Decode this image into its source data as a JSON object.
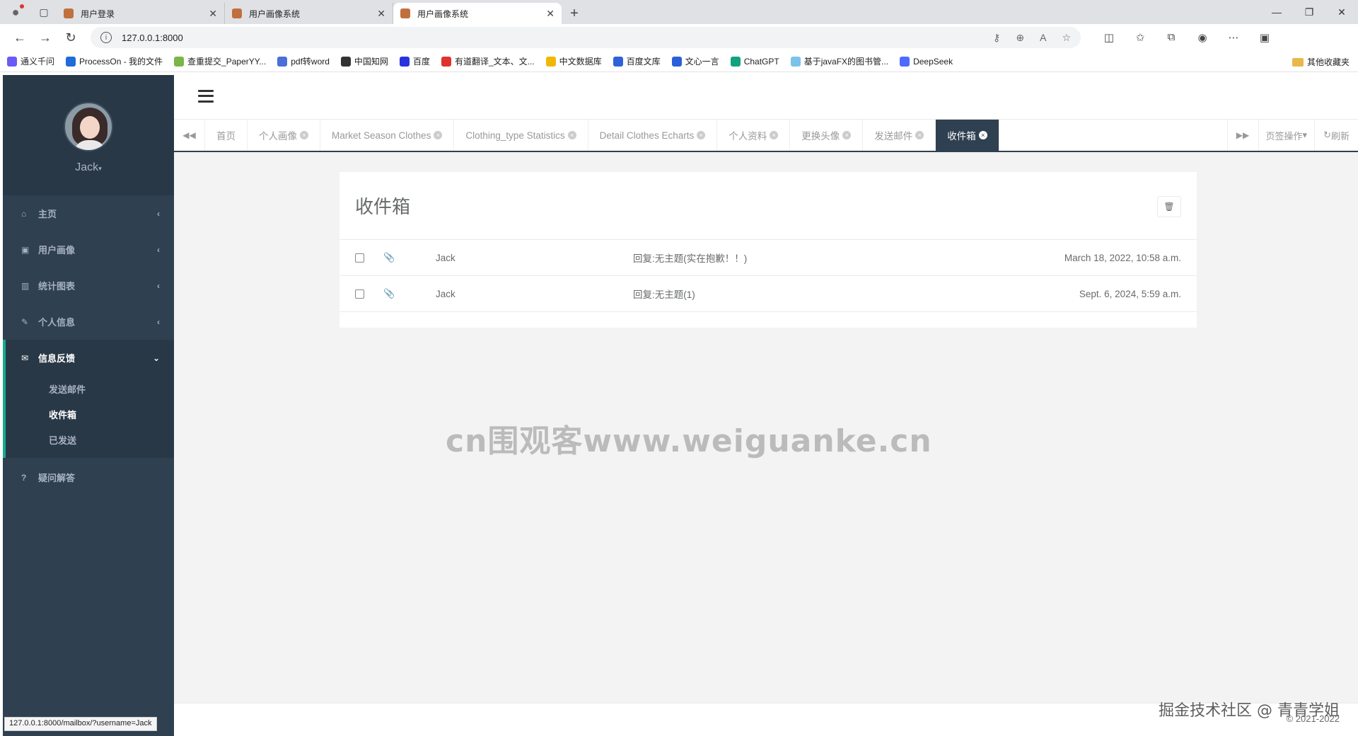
{
  "browser": {
    "tabs": [
      {
        "title": "用户登录"
      },
      {
        "title": "用户画像系统"
      },
      {
        "title": "用户画像系统"
      }
    ],
    "url": "127.0.0.1:8000",
    "bookmarks": [
      {
        "label": "通义千问",
        "color": "#6a5af9"
      },
      {
        "label": "ProcessOn - 我的文件",
        "color": "#1f6bd8"
      },
      {
        "label": "查重提交_PaperYY...",
        "color": "#7ab648"
      },
      {
        "label": "pdf转word",
        "color": "#4a6fd8"
      },
      {
        "label": "中国知网",
        "color": "#333333"
      },
      {
        "label": "百度",
        "color": "#2932e1"
      },
      {
        "label": "有道翻译_文本、文...",
        "color": "#e0322e"
      },
      {
        "label": "中文数据库",
        "color": "#f2b705"
      },
      {
        "label": "百度文库",
        "color": "#2f62d8"
      },
      {
        "label": "文心一言",
        "color": "#2b5fd9"
      },
      {
        "label": "ChatGPT",
        "color": "#10a37f"
      },
      {
        "label": "基于javaFX的图书管...",
        "color": "#7bc3ea"
      },
      {
        "label": "DeepSeek",
        "color": "#4d6bfe"
      }
    ],
    "other_bookmarks": "其他收藏夹",
    "status_url": "127.0.0.1:8000/mailbox/?username=Jack"
  },
  "sidebar": {
    "username": "Jack",
    "menu": [
      {
        "label": "主页",
        "icon": "home-icon",
        "glyph": "⌂"
      },
      {
        "label": "用户画像",
        "icon": "picture-icon",
        "glyph": "▣"
      },
      {
        "label": "统计图表",
        "icon": "bar-chart-icon",
        "glyph": "▥"
      },
      {
        "label": "个人信息",
        "icon": "edit-icon",
        "glyph": "✎"
      }
    ],
    "open_menu": {
      "label": "信息反馈",
      "icon": "envelope-icon",
      "glyph": "✉",
      "items": [
        {
          "label": "发送邮件"
        },
        {
          "label": "收件箱"
        },
        {
          "label": "已发送"
        }
      ]
    },
    "faq": "疑问解答"
  },
  "page_tabs": [
    {
      "label": "首页",
      "closable": false
    },
    {
      "label": "个人画像",
      "closable": true
    },
    {
      "label": "Market Season Clothes",
      "closable": true
    },
    {
      "label": "Clothing_type Statistics",
      "closable": true
    },
    {
      "label": "Detail Clothes Echarts",
      "closable": true
    },
    {
      "label": "个人资料",
      "closable": true
    },
    {
      "label": "更换头像",
      "closable": true
    },
    {
      "label": "发送邮件",
      "closable": true
    },
    {
      "label": "收件箱",
      "closable": true,
      "active": true
    }
  ],
  "tab_ops": {
    "ops_label": "页签操作",
    "refresh_label": "刷新"
  },
  "mailbox": {
    "title": "收件箱",
    "messages": [
      {
        "from": "Jack",
        "subject": "回复:无主题(实在抱歉！！)",
        "date": "March 18, 2022, 10:58 a.m."
      },
      {
        "from": "Jack",
        "subject": "回复:无主题(1)",
        "date": "Sept. 6, 2024, 5:59 a.m."
      }
    ]
  },
  "watermark": "cn围观客www.weiguanke.cn",
  "footer": {
    "copyright": "© 2021-2022",
    "signature": "掘金技术社区 @ 青青学姐"
  },
  "colors": {
    "sidebar": "#2f4050",
    "accent": "#19aa8d",
    "active_tab": "#2f4050"
  }
}
